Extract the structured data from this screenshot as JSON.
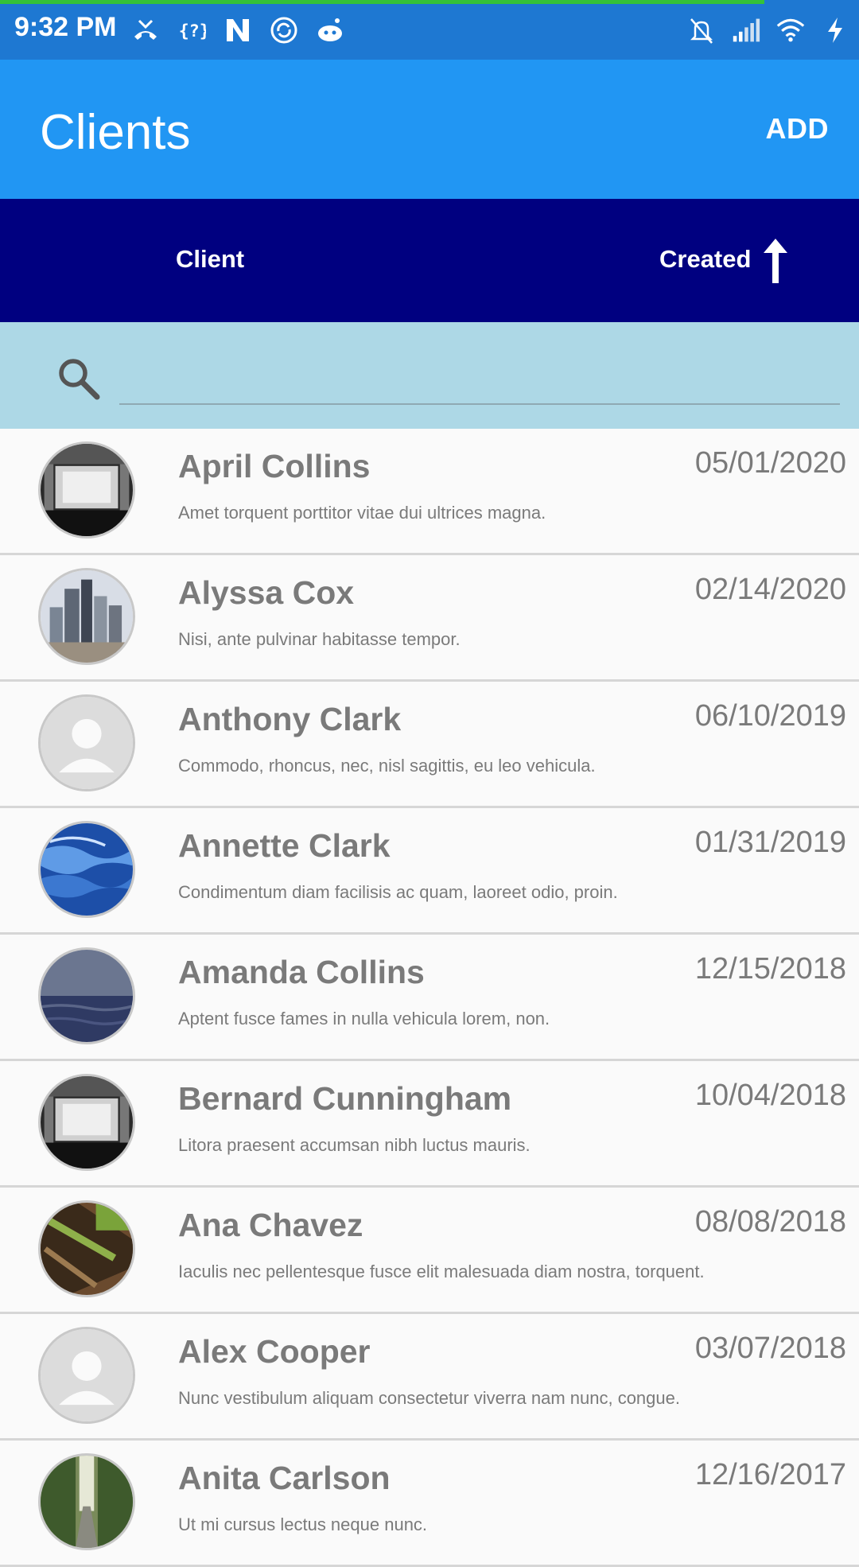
{
  "status_bar": {
    "time": "9:32 PM",
    "progress_fraction": 0.89,
    "left_icons": [
      "missed-call-icon",
      "code-icon",
      "n-app-icon",
      "sync-icon",
      "reddit-icon"
    ],
    "right_icons": [
      "bell-off-icon",
      "signal-icon",
      "wifi-icon",
      "charging-icon"
    ]
  },
  "app_bar": {
    "title": "Clients",
    "add_label": "ADD",
    "color": "#2196f3"
  },
  "sort_header": {
    "client_label": "Client",
    "created_label": "Created",
    "sort_direction": "ascending-arrow-up",
    "color": "#000080"
  },
  "search": {
    "placeholder": "",
    "value": ""
  },
  "clients": [
    {
      "name": "April Collins",
      "date": "05/01/2020",
      "desc": "Amet torquent porttitor vitae dui ultrices magna.",
      "avatar": "cinema"
    },
    {
      "name": "Alyssa Cox",
      "date": "02/14/2020",
      "desc": "Nisi, ante pulvinar habitasse tempor.",
      "avatar": "city"
    },
    {
      "name": "Anthony Clark",
      "date": "06/10/2019",
      "desc": "Commodo, rhoncus, nec, nisl sagittis, eu leo vehicula.",
      "avatar": "placeholder"
    },
    {
      "name": "Annette Clark",
      "date": "01/31/2019",
      "desc": "Condimentum diam facilisis ac quam, laoreet odio, proin.",
      "avatar": "water"
    },
    {
      "name": "Amanda Collins",
      "date": "12/15/2018",
      "desc": "Aptent fusce fames in nulla vehicula lorem, non.",
      "avatar": "sea"
    },
    {
      "name": "Bernard Cunningham",
      "date": "10/04/2018",
      "desc": "Litora praesent accumsan nibh luctus mauris.",
      "avatar": "cinema"
    },
    {
      "name": "Ana Chavez",
      "date": "08/08/2018",
      "desc": "Iaculis nec pellentesque fusce elit malesuada diam nostra, torquent.",
      "avatar": "bark"
    },
    {
      "name": "Alex Cooper",
      "date": "03/07/2018",
      "desc": "Nunc vestibulum aliquam consectetur viverra nam nunc, congue.",
      "avatar": "placeholder"
    },
    {
      "name": "Anita Carlson",
      "date": "12/16/2017",
      "desc": "Ut mi cursus lectus neque nunc.",
      "avatar": "forest"
    }
  ]
}
